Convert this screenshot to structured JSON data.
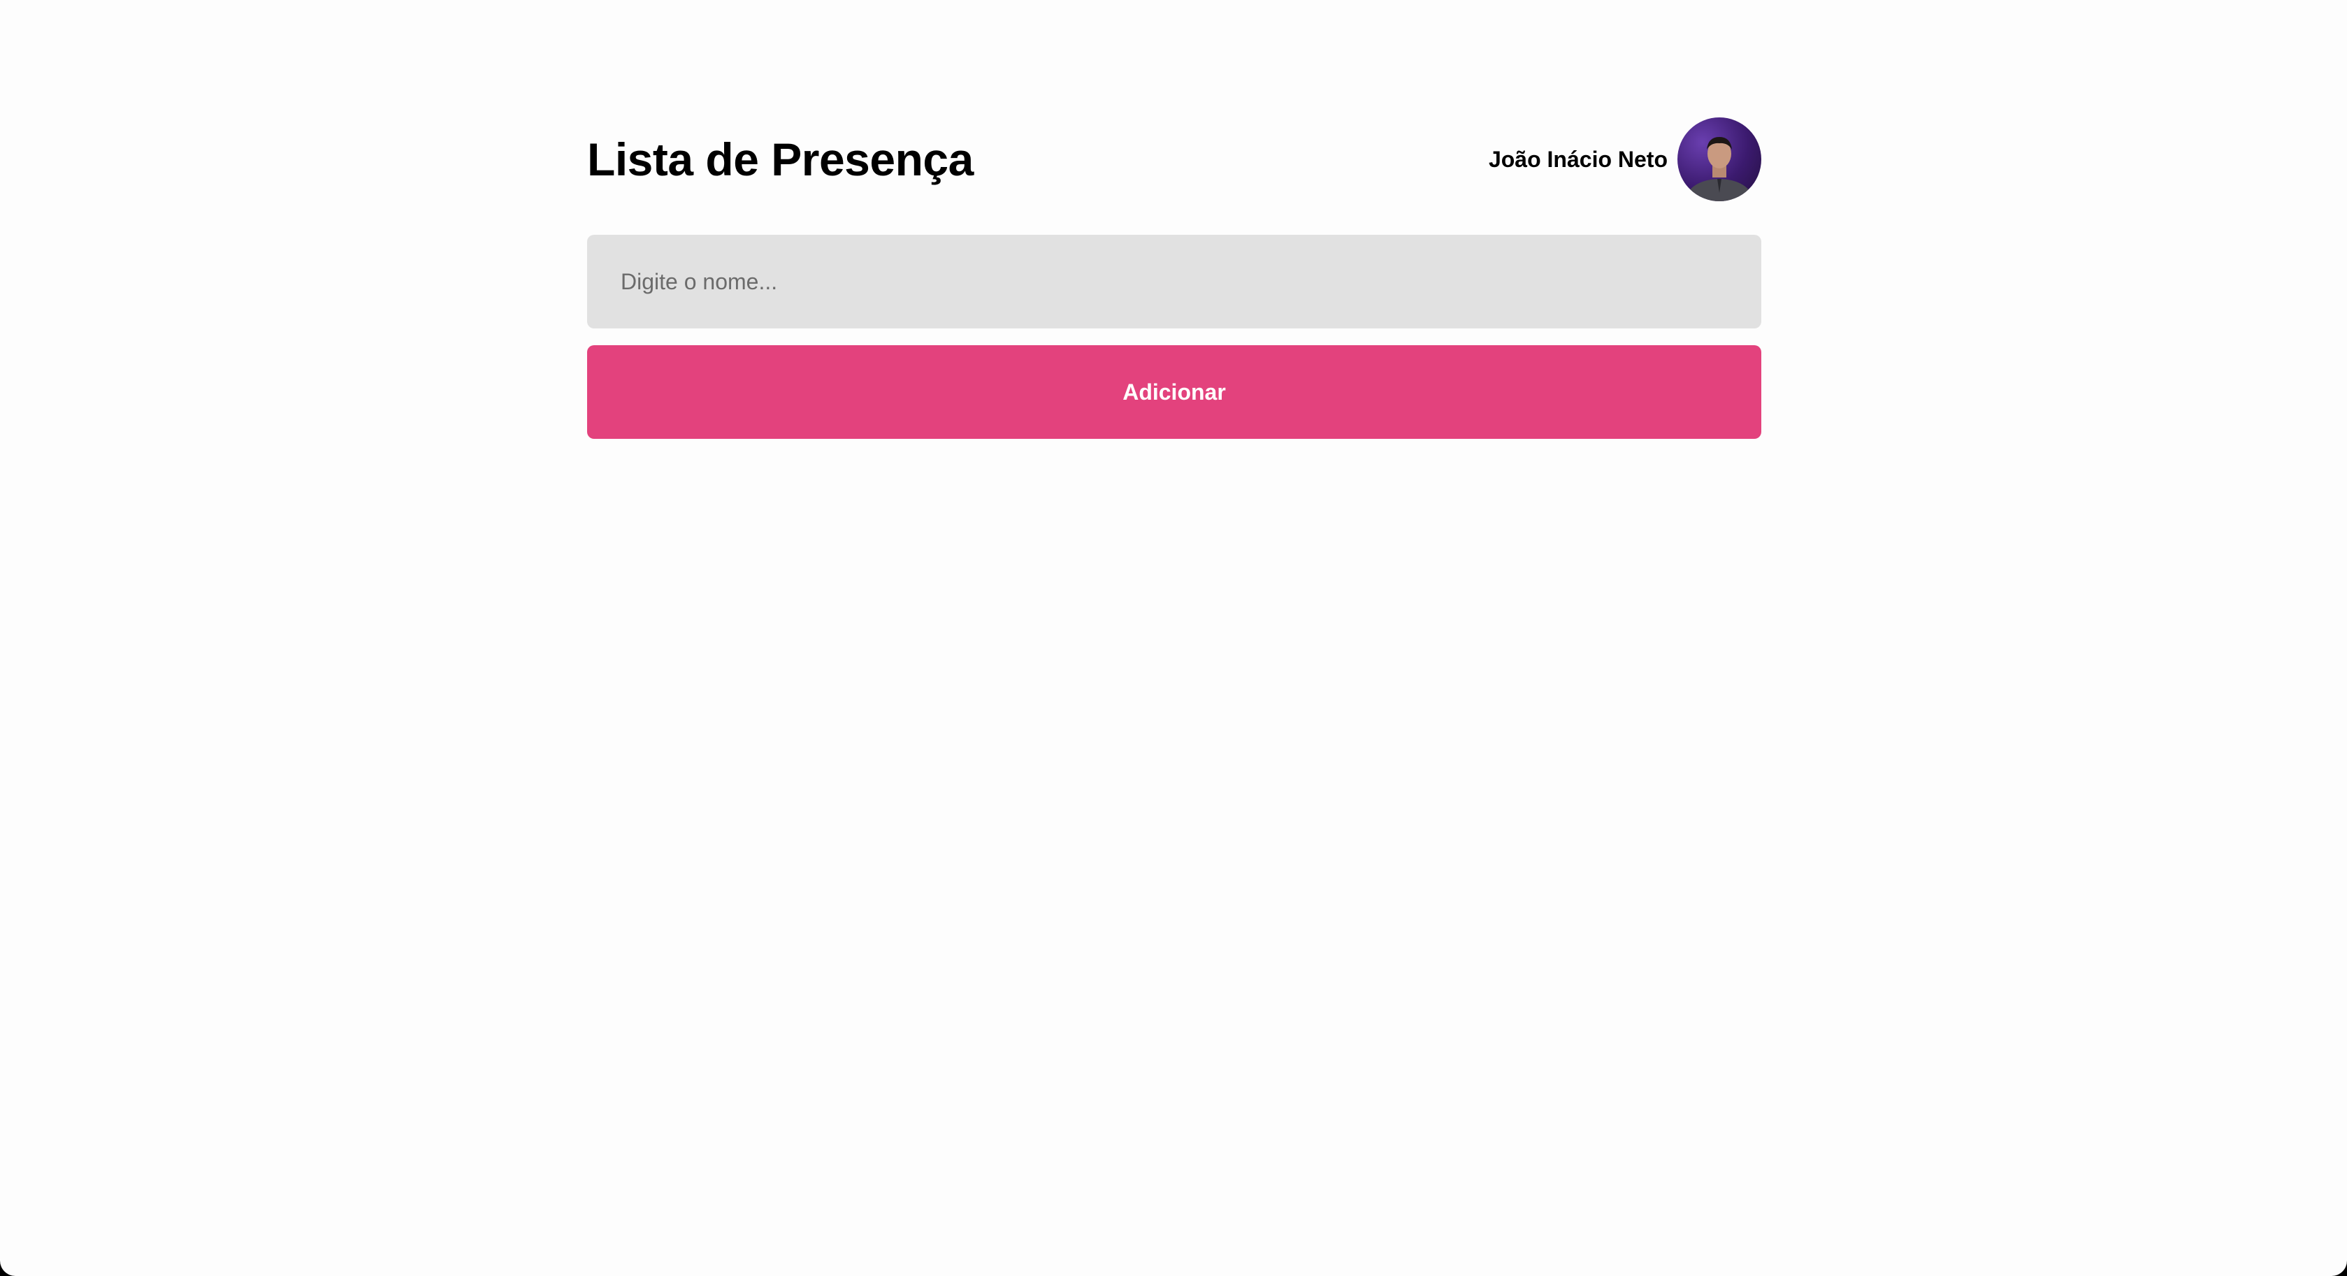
{
  "header": {
    "title": "Lista de Presença",
    "user_name": "João Inácio Neto",
    "avatar_icon": "user-avatar-photo"
  },
  "form": {
    "name_placeholder": "Digite o nome...",
    "name_value": "",
    "add_button_label": "Adicionar"
  },
  "colors": {
    "accent": "#e3427d",
    "input_background": "#e1e1e1",
    "page_background": "#fdfdfd"
  }
}
